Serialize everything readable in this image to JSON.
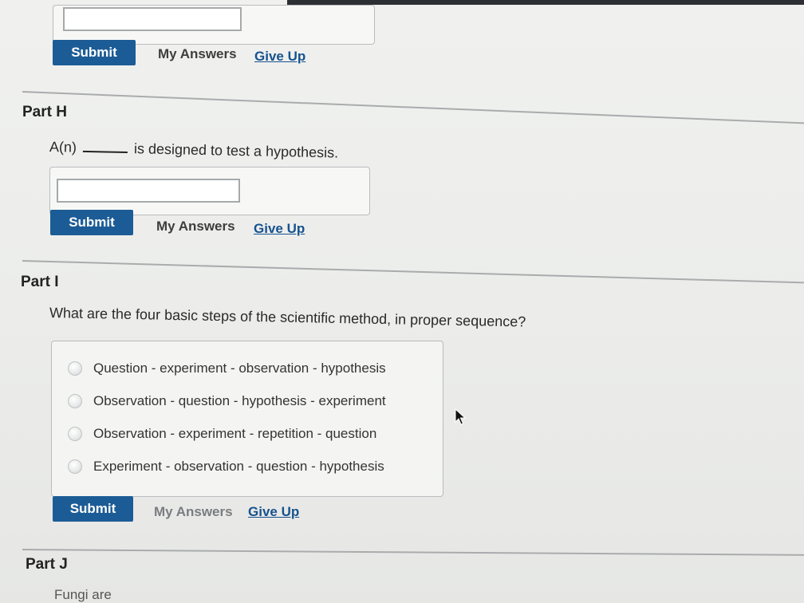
{
  "part_g": {
    "input_value": "",
    "submit_label": "Submit",
    "my_answers_label": "My Answers",
    "give_up_label": "Give Up"
  },
  "part_h": {
    "title": "Part H",
    "prompt_before": "A(n)",
    "prompt_after": "is designed to test a hypothesis.",
    "input_value": "",
    "submit_label": "Submit",
    "my_answers_label": "My Answers",
    "give_up_label": "Give Up"
  },
  "part_i": {
    "title": "Part I",
    "question": "What are the four basic steps of the scientific method, in proper sequence?",
    "options": [
      "Question - experiment - observation - hypothesis",
      "Observation - question - hypothesis - experiment",
      "Observation - experiment - repetition - question",
      "Experiment - observation - question - hypothesis"
    ],
    "submit_label": "Submit",
    "my_answers_label": "My Answers",
    "give_up_label": "Give Up"
  },
  "part_j": {
    "title": "Part J",
    "prompt": "Fungi are"
  },
  "icons": {
    "cursor": "mouse-pointer-icon",
    "radio": "radio-unselected-icon"
  },
  "colors": {
    "submit_button": "#1c5c96",
    "link": "#17528e",
    "background": "#eeefed"
  }
}
